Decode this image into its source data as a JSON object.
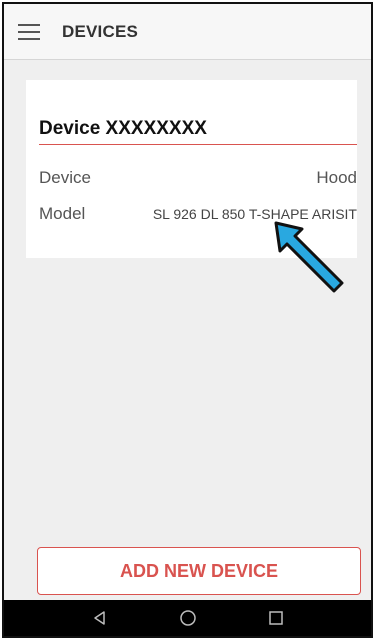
{
  "app_bar": {
    "title": "DEVICES",
    "menu_icon": "hamburger-menu-icon"
  },
  "device_card": {
    "name": "Device XXXXXXXX",
    "rows": [
      {
        "label": "Device",
        "value": "Hood"
      },
      {
        "label": "Model",
        "value": "SL 926 DL 850 T-SHAPE ARISIT"
      }
    ]
  },
  "annotation": {
    "icon": "pointer-arrow-icon",
    "color": "#29a8e0"
  },
  "add_button": {
    "label": "ADD NEW DEVICE"
  },
  "nav_bar": {
    "items": [
      "back-icon",
      "home-icon",
      "recents-icon"
    ]
  },
  "colors": {
    "accent": "#d9534f",
    "background": "#efefef",
    "card": "#ffffff",
    "app_bar": "#f7f7f7",
    "nav_bar": "#000000"
  }
}
